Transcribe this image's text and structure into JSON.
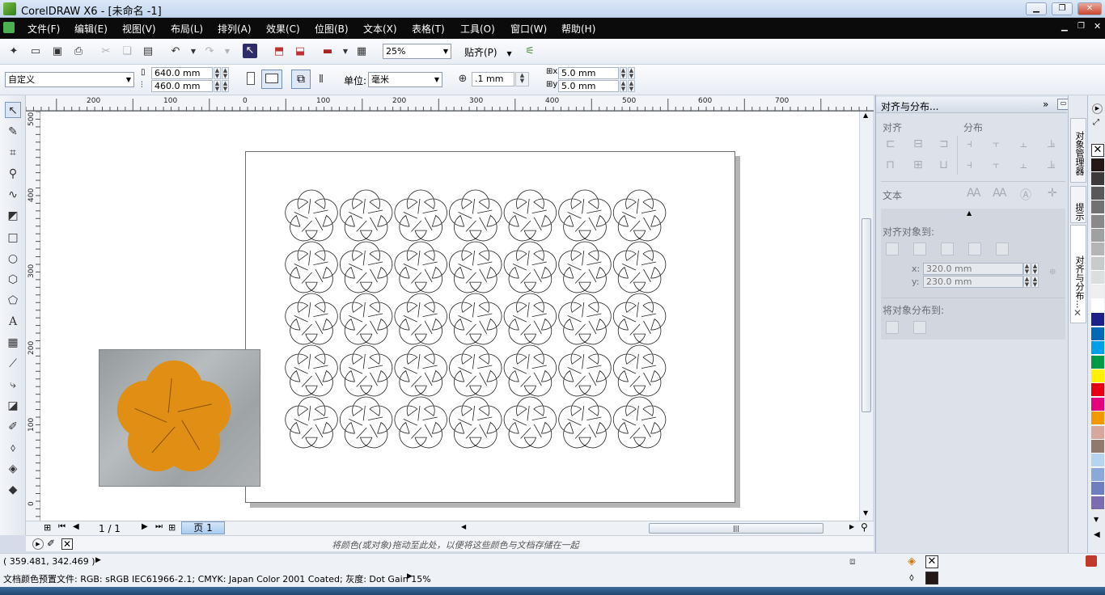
{
  "window": {
    "title": "CorelDRAW X6 - [未命名 -1]"
  },
  "menu": [
    "文件(F)",
    "编辑(E)",
    "视图(V)",
    "布局(L)",
    "排列(A)",
    "效果(C)",
    "位图(B)",
    "文本(X)",
    "表格(T)",
    "工具(O)",
    "窗口(W)",
    "帮助(H)"
  ],
  "toolbar": {
    "zoom": "25%",
    "snap": "贴齐(P)"
  },
  "property_bar": {
    "page_preset": "自定义",
    "width": "640.0 mm",
    "height": "460.0 mm",
    "units_label": "单位:",
    "units": "毫米",
    "nudge": ".1 mm",
    "dup_x": "5.0 mm",
    "dup_y": "5.0 mm"
  },
  "rulers": {
    "h": [
      "200",
      "100",
      "0",
      "100",
      "200",
      "300",
      "400",
      "500",
      "600",
      "700"
    ],
    "v": [
      "500",
      "400",
      "300",
      "200",
      "100",
      "0"
    ]
  },
  "pages": {
    "counter": "1 / 1",
    "tab": "页 1"
  },
  "doc_palette_hint": "将颜色(或对象)拖动至此处，以便将这些颜色与文档存储在一起",
  "status": {
    "coords": "( 359.481, 342.469 )",
    "color_profile": "文档颜色预置文件: RGB: sRGB IEC61966-2.1; CMYK: Japan Color 2001 Coated; 灰度: Dot Gain 15%"
  },
  "docker": {
    "title": "对齐与分布...",
    "align": "对齐",
    "distribute": "分布",
    "text": "文本",
    "align_to": "对齐对象到:",
    "x_label": "x:",
    "y_label": "y:",
    "x": "320.0 mm",
    "y": "230.0 mm",
    "distribute_to": "将对象分布到:"
  },
  "vertical_tabs": [
    "对象管理器",
    "提示",
    "对齐与分布..."
  ],
  "palette": [
    "#231815",
    "#3e3a39",
    "#595757",
    "#727171",
    "#898989",
    "#9fa0a0",
    "#b5b5b6",
    "#c9caca",
    "#dcdddd",
    "#efefef",
    "#ffffff",
    "#1d2088",
    "#0068b7",
    "#00a0e9",
    "#009944",
    "#fff100",
    "#e60012",
    "#e4007f",
    "#f39800",
    "#d7a79b",
    "#8f7a6b",
    "#b7d4ee",
    "#8ba9d8",
    "#6d7fc0",
    "#7b6bb1"
  ],
  "photo_color": "#e08f14"
}
